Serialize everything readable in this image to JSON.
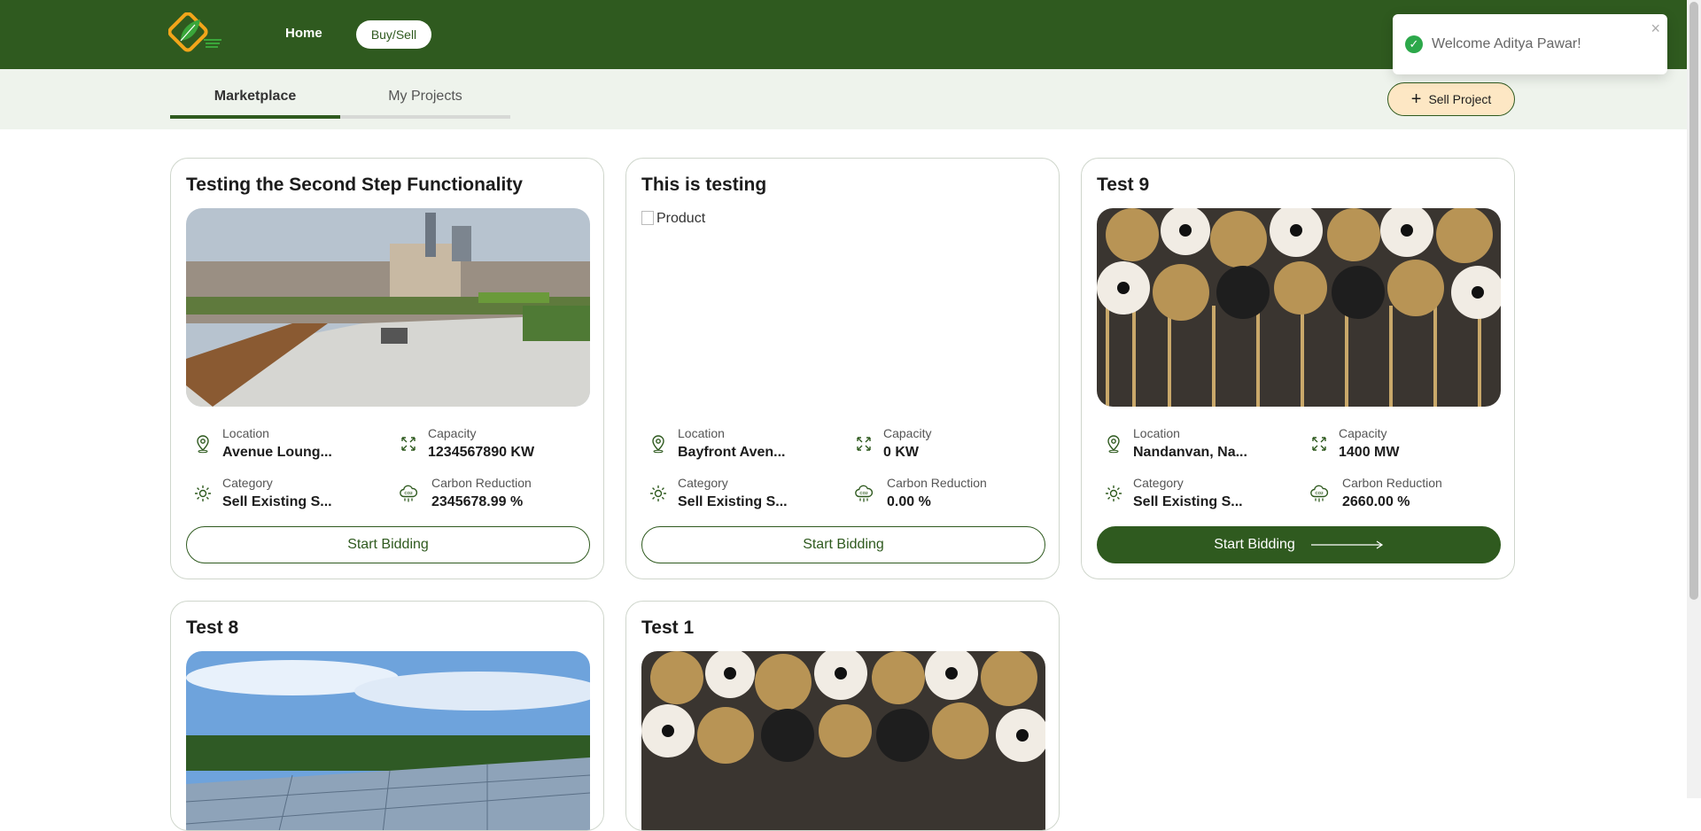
{
  "nav": {
    "home": "Home",
    "buy_sell": "Buy/Sell"
  },
  "tabs": {
    "marketplace": "Marketplace",
    "my_projects": "My Projects"
  },
  "sell_project": "Sell Project",
  "toast": {
    "message": "Welcome Aditya Pawar!"
  },
  "labels": {
    "location": "Location",
    "capacity": "Capacity",
    "category": "Category",
    "carbon": "Carbon Reduction",
    "bid": "Start Bidding",
    "broken_alt": "Product"
  },
  "cards": [
    {
      "title": "Testing the Second Step Functionality",
      "location": "Avenue Loung...",
      "capacity": "1234567890 KW",
      "category": "Sell Existing S...",
      "carbon": "2345678.99 %"
    },
    {
      "title": "This is testing",
      "location": "Bayfront Aven...",
      "capacity": "0 KW",
      "category": "Sell Existing S...",
      "carbon": "0.00 %"
    },
    {
      "title": "Test 9",
      "location": "Nandanvan, Na...",
      "capacity": "1400 MW",
      "category": "Sell Existing S...",
      "carbon": "2660.00 %"
    },
    {
      "title": "Test 8"
    },
    {
      "title": "Test 1"
    }
  ],
  "colors": {
    "brand": "#2f5a1f",
    "subbar": "#eef3ec",
    "sell_bg": "#fde7c4"
  }
}
